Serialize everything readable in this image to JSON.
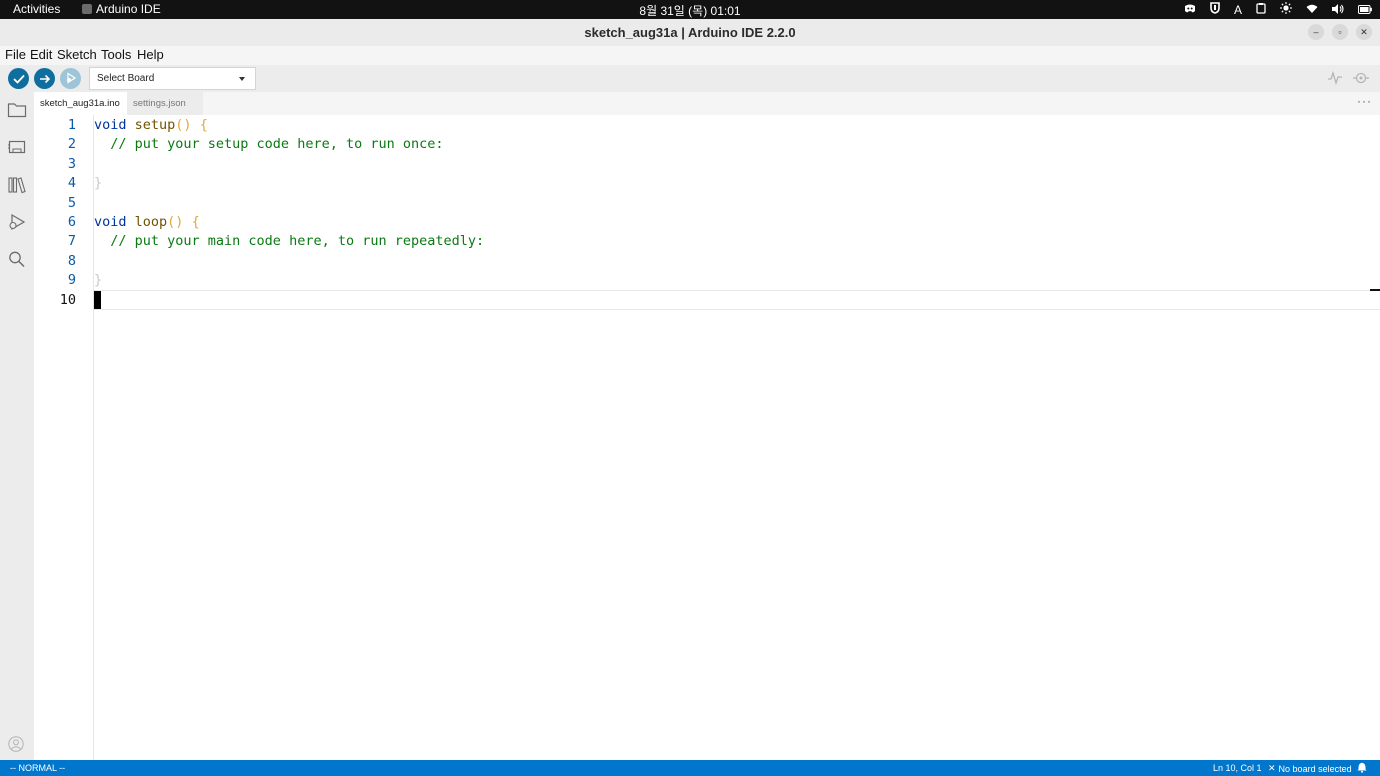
{
  "topbar": {
    "activities": "Activities",
    "app_name": "Arduino IDE",
    "clock": "8월 31일 (목) 01:01",
    "input_method": "A"
  },
  "window": {
    "title": "sketch_aug31a | Arduino IDE 2.2.0",
    "minimize": "–",
    "maximize": "▫",
    "close": "✕"
  },
  "menu": {
    "file": "File",
    "edit": "Edit",
    "sketch": "Sketch",
    "tools": "Tools",
    "help": "Help"
  },
  "toolbar": {
    "board_select": "Select Board",
    "icons": [
      "verify-icon",
      "upload-icon",
      "debug-icon",
      "serial-plotter-icon",
      "serial-monitor-icon"
    ]
  },
  "sidebar": {
    "icons": [
      "sketchbook-icon",
      "boards-manager-icon",
      "library-manager-icon",
      "debug-icon",
      "search-icon",
      "account-icon"
    ]
  },
  "tabs": {
    "active": "sketch_aug31a.ino",
    "second": "settings.json",
    "more": "···"
  },
  "editor": {
    "line_numbers": [
      "1",
      "2",
      "3",
      "4",
      "5",
      "6",
      "7",
      "8",
      "9",
      "10"
    ],
    "line1": {
      "kw": "void",
      "fn": "setup",
      "paren": "()",
      "brace": "{"
    },
    "line2_comment": "  // put your setup code here, to run once:",
    "line4": "}",
    "line6": {
      "kw": "void",
      "fn": "loop",
      "paren": "()",
      "brace": "{"
    },
    "line7_comment": "  // put your main code here, to run repeatedly:",
    "line9": "}"
  },
  "status": {
    "mode": "-- NORMAL --",
    "position": "Ln 10, Col 1",
    "board": "No board selected"
  },
  "colors": {
    "accent": "#0077cc",
    "toolbar_button": "#0f6e9e",
    "comment": "#0a7a12",
    "keyword": "#00339e"
  }
}
